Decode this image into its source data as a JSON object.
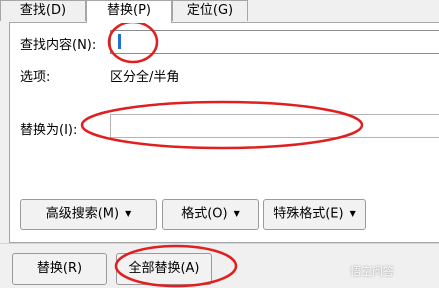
{
  "tabs": [
    {
      "label": "查找(D)"
    },
    {
      "label": "替换(P)"
    },
    {
      "label": "定位(G)"
    }
  ],
  "find": {
    "label": "查找内容(N):",
    "value": ""
  },
  "options": {
    "label": "选项:",
    "value": "区分全/半角"
  },
  "replace": {
    "label": "替换为(I):",
    "value": ""
  },
  "buttons": {
    "more": "高级搜索(M)",
    "format": "格式(O)",
    "special": "特殊格式(E)",
    "replace": "替换(R)",
    "replace_all": "全部替换(A)"
  },
  "watermark": "悟空问答",
  "colors": {
    "annotation": "#e02020",
    "caret": "#1f6fd6"
  }
}
